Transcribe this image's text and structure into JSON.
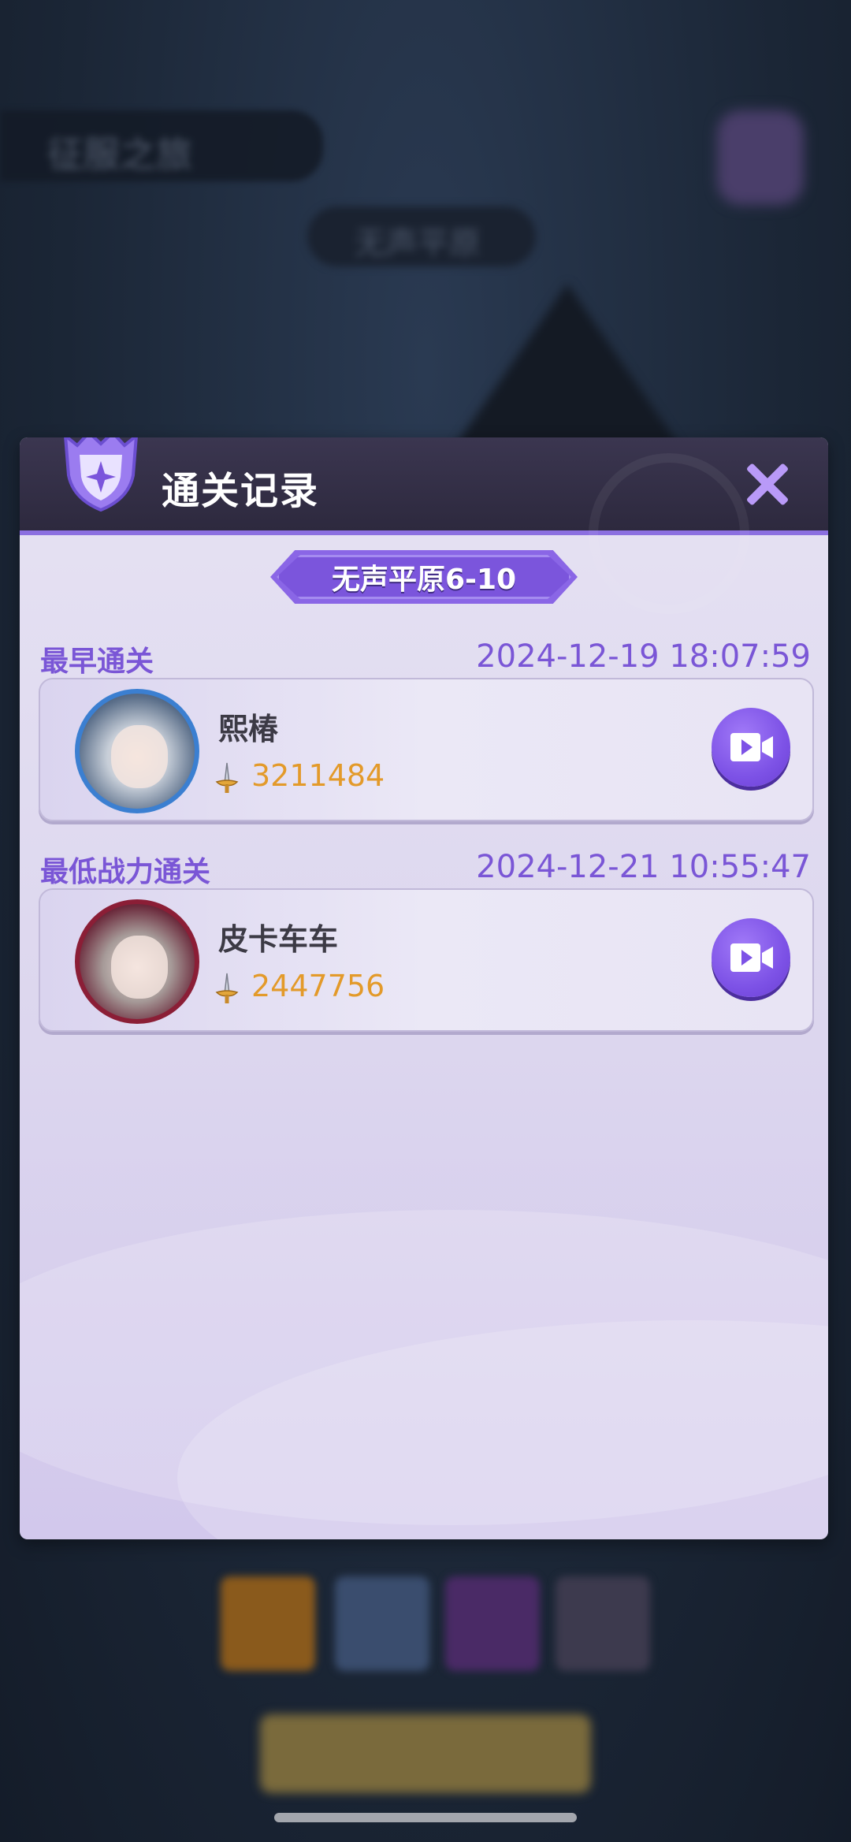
{
  "background": {
    "title_text": "征服之旅",
    "pill_text": "无声平原"
  },
  "dialog": {
    "title": "通关记录",
    "close_icon": "close-icon",
    "stage_name": "无声平原6-10",
    "records": [
      {
        "section_label": "最早通关",
        "timestamp": "2024-12-19 18:07:59",
        "player_name": "熙椿",
        "power": "3211484"
      },
      {
        "section_label": "最低战力通关",
        "timestamp": "2024-12-21 10:55:47",
        "player_name": "皮卡车车",
        "power": "2447756"
      }
    ]
  },
  "colors": {
    "accent": "#7b55dc",
    "power_text": "#e39a2a",
    "label_text": "#7a56d6"
  }
}
